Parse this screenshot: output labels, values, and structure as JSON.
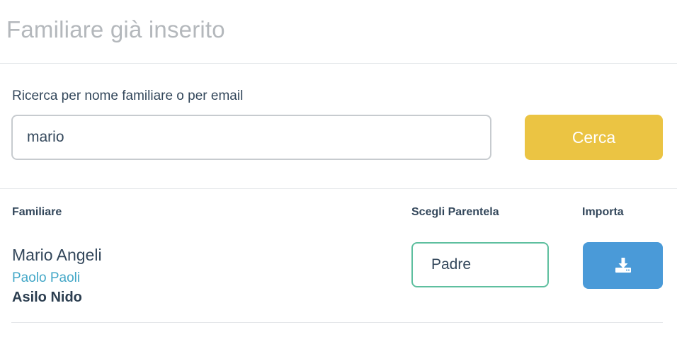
{
  "modal": {
    "title": "Familiare già inserito"
  },
  "search": {
    "label": "Ricerca per nome familiare o per email",
    "value": "mario",
    "button_label": "Cerca"
  },
  "table": {
    "headers": {
      "familiare": "Familiare",
      "parentela": "Scegli Parentela",
      "importa": "Importa"
    },
    "rows": [
      {
        "name": "Mario Angeli",
        "child": "Paolo Paoli",
        "school": "Asilo Nido",
        "relation": "Padre",
        "import_icon": "download-icon"
      }
    ]
  },
  "colors": {
    "title": "#b4b8bc",
    "text": "#33475b",
    "search_button": "#ebc443",
    "import_button": "#4a9ad8",
    "select_border": "#5ebf9f",
    "child_link": "#42a7c7"
  }
}
